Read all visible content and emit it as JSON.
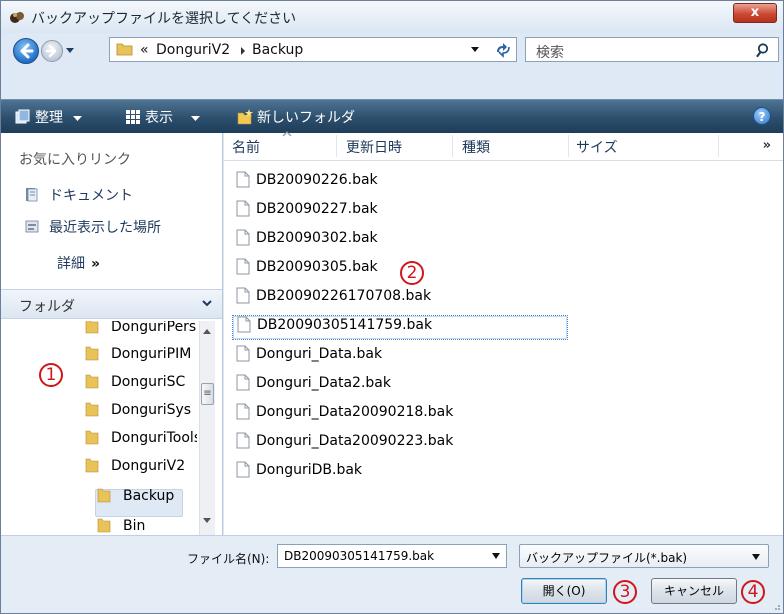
{
  "window": {
    "title": "バックアップファイルを選択してください",
    "close_label": "x"
  },
  "address": {
    "crumb_prefix": "«",
    "crumbs": [
      "DonguriV2",
      "Backup"
    ],
    "search_placeholder": "検索"
  },
  "toolbar": {
    "organize": "整理",
    "views": "表示",
    "new_folder": "新しいフォルダ",
    "help": "?"
  },
  "nav": {
    "favorites_header": "お気に入りリンク",
    "favorites": [
      "ドキュメント",
      "最近表示した場所"
    ],
    "more_label": "詳細",
    "more_chevron": "»",
    "folders_header": "フォルダ",
    "tree": [
      "DonguriPersonal",
      "DonguriPIM",
      "DonguriSC",
      "DonguriSys",
      "DonguriTools",
      "DonguriV2",
      "Backup",
      "Bin"
    ],
    "selected_folder": "Backup"
  },
  "columns": {
    "name": "名前",
    "modified": "更新日時",
    "type": "種類",
    "size": "サイズ",
    "more": "»"
  },
  "files": [
    "DB20090226.bak",
    "DB20090227.bak",
    "DB20090302.bak",
    "DB20090305.bak",
    "DB20090226170708.bak",
    "DB20090305141759.bak",
    "Donguri_Data.bak",
    "Donguri_Data2.bak",
    "Donguri_Data20090218.bak",
    "Donguri_Data20090223.bak",
    "DonguriDB.bak"
  ],
  "selected_file_index": 5,
  "bottom": {
    "filename_label": "ファイル名(N):",
    "filename_value": "DB20090305141759.bak",
    "filter_value": "バックアップファイル(*.bak)",
    "open_button": "開く(O)",
    "cancel_button": "キャンセル"
  },
  "annotations": {
    "m1": "1",
    "m2": "2",
    "m3": "3",
    "m4": "4"
  },
  "colors": {
    "marker": "#d0161a",
    "toolbar": "#2c4f6d",
    "selection_border": "#4a87c7"
  }
}
